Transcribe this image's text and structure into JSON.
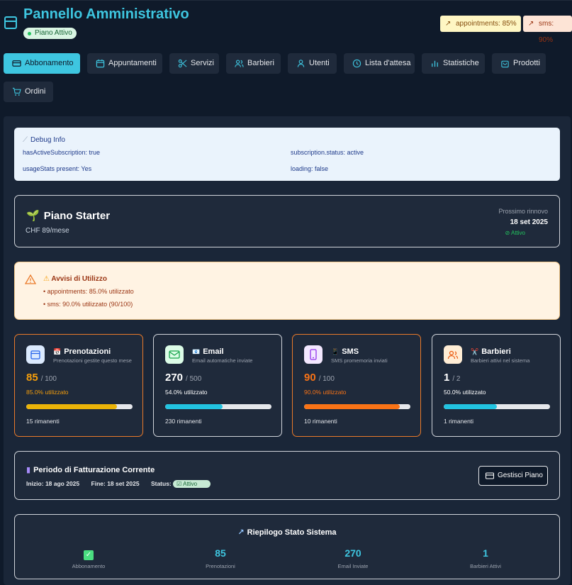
{
  "header": {
    "title": "Pannello Amministrativo",
    "plan_badge": "Piano Attivo",
    "warnings": [
      "appointments: 85%",
      "sms: 90%"
    ]
  },
  "nav": [
    {
      "label": "Abbonamento",
      "icon": "card-icon",
      "active": true
    },
    {
      "label": "Appuntamenti",
      "icon": "calendar-icon"
    },
    {
      "label": "Servizi",
      "icon": "scissors-icon"
    },
    {
      "label": "Barbieri",
      "icon": "users-icon"
    },
    {
      "label": "Utenti",
      "icon": "user-icon"
    },
    {
      "label": "Lista d'attesa",
      "icon": "clock-icon"
    },
    {
      "label": "Statistiche",
      "icon": "bar-chart-icon"
    },
    {
      "label": "Prodotti",
      "icon": "bag-icon"
    },
    {
      "label": "Ordini",
      "icon": "cart-icon"
    }
  ],
  "debug": {
    "title": "Debug Info",
    "items": [
      "hasActiveSubscription: true",
      "subscription.status: active",
      "usageStats present: Yes",
      "loading: false"
    ]
  },
  "plan": {
    "name": "Piano Starter",
    "price": "CHF 89/mese",
    "renewal_label": "Prossimo rinnovo",
    "renewal_date": "18 set 2025",
    "status": "Attivo"
  },
  "alert": {
    "title": "Avvisi di Utilizzo",
    "lines": [
      "• appointments: 85.0% utilizzato",
      "• sms: 90.0% utilizzato (90/100)"
    ]
  },
  "usage": [
    {
      "title": "Prenotazioni",
      "subtitle": "Prenotazioni gestite questo mese",
      "value": "85",
      "limit": "/ 100",
      "percent": "85.0% utilizzato",
      "remaining": "15 rimanenti",
      "fill": 0.85,
      "bar_color": "#eab308",
      "value_color": "#f59e0b",
      "pct_color": "#f59e0b",
      "warn": true,
      "icon": "calendar-icon",
      "emoji": "📅"
    },
    {
      "title": "Email",
      "subtitle": "Email automatiche inviate",
      "value": "270",
      "limit": "/ 500",
      "percent": "54.0% utilizzato",
      "remaining": "230 rimanenti",
      "fill": 0.54,
      "bar_color": "#22c3e0",
      "value_color": "#ffffff",
      "pct_color": "#ffffff",
      "warn": false,
      "icon": "mail-icon",
      "emoji": "📧"
    },
    {
      "title": "SMS",
      "subtitle": "SMS promemoria inviati",
      "value": "90",
      "limit": "/ 100",
      "percent": "90.0% utilizzato",
      "remaining": "10 rimanenti",
      "fill": 0.9,
      "bar_color": "#f97316",
      "value_color": "#f97316",
      "pct_color": "#f97316",
      "warn": true,
      "icon": "phone-icon",
      "emoji": "📱"
    },
    {
      "title": "Barbieri",
      "subtitle": "Barbieri attivi nel sistema",
      "value": "1",
      "limit": "/ 2",
      "percent": "50.0% utilizzato",
      "remaining": "1 rimanenti",
      "fill": 0.5,
      "bar_color": "#22c3e0",
      "value_color": "#ffffff",
      "pct_color": "#ffffff",
      "warn": false,
      "icon": "people-icon",
      "emoji": "✂️"
    }
  ],
  "billing": {
    "title": "Periodo di Fatturazione Corrente",
    "start_label": "Inizio:",
    "start": "18 ago 2025",
    "end_label": "Fine:",
    "end": "18 set 2025",
    "status_label": "Status:",
    "status": "Attivo",
    "manage_button": "Gestisci Piano"
  },
  "summary": {
    "title": "Riepilogo Stato Sistema",
    "items": [
      {
        "value": "",
        "label": "Abbonamento"
      },
      {
        "value": "85",
        "label": "Prenotazioni"
      },
      {
        "value": "270",
        "label": "Email Inviate"
      },
      {
        "value": "1",
        "label": "Barbieri Attivi"
      }
    ]
  },
  "colors": {
    "accent": "#3ec6e0",
    "background": "#0f1a2a",
    "card": "#1f2a3b",
    "warning_border": "#ea7a2a"
  }
}
